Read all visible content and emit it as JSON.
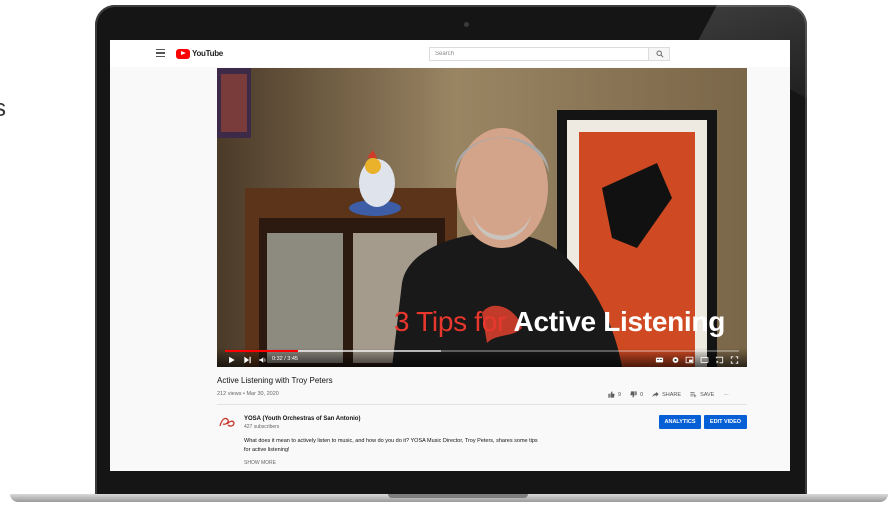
{
  "edge_text": "s",
  "header": {
    "logo_text": "YouTube",
    "search_placeholder": "Search"
  },
  "video": {
    "overlay_red": "3 Tips for ",
    "overlay_white": "Active Listening",
    "time": "0:32 / 3:45",
    "progress_fraction": 0.142,
    "buffer_fraction": 0.42,
    "title": "Active Listening with Troy Peters",
    "meta": "212 views • Mar 30, 2020",
    "likes": "9",
    "dislikes": "0",
    "share_label": "SHARE",
    "save_label": "SAVE",
    "more_label": "···"
  },
  "channel": {
    "name": "YOSA (Youth Orchestras of San Antonio)",
    "subscribers": "427 subscribers",
    "analytics_label": "ANALYTICS",
    "edit_label": "EDIT VIDEO",
    "description": "What does it mean to actively listen to music, and how do you do it? YOSA Music Director, Troy Peters, shares some tips for active listening!",
    "show_more": "SHOW MORE"
  },
  "colors": {
    "accent_red": "#ff0000",
    "button_blue": "#065fd4",
    "overlay_red": "#e8372c"
  }
}
